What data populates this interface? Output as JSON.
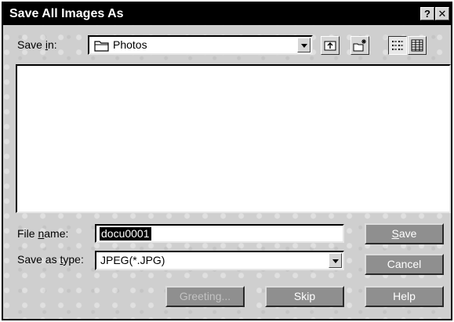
{
  "window": {
    "title": "Save All Images As",
    "help_glyph": "?",
    "close_glyph": "✕"
  },
  "save_in": {
    "label_pre": "Save ",
    "label_u": "i",
    "label_post": "n:",
    "value": "Photos"
  },
  "file_name": {
    "label_pre": "File ",
    "label_u": "n",
    "label_post": "ame:",
    "value": "docu0001"
  },
  "save_as_type": {
    "label_pre": "Save as ",
    "label_u": "t",
    "label_post": "ype:",
    "value": "JPEG(*.JPG)"
  },
  "buttons": {
    "save_u": "S",
    "save_rest": "ave",
    "cancel": "Cancel",
    "greeting": "Greeting...",
    "skip": "Skip",
    "help": "Help"
  },
  "icons": {
    "folder": "folder-icon",
    "up_one_level": "up-folder-icon",
    "new_folder": "new-folder-icon",
    "list_view": "list-view-icon",
    "details_view": "details-view-icon"
  }
}
